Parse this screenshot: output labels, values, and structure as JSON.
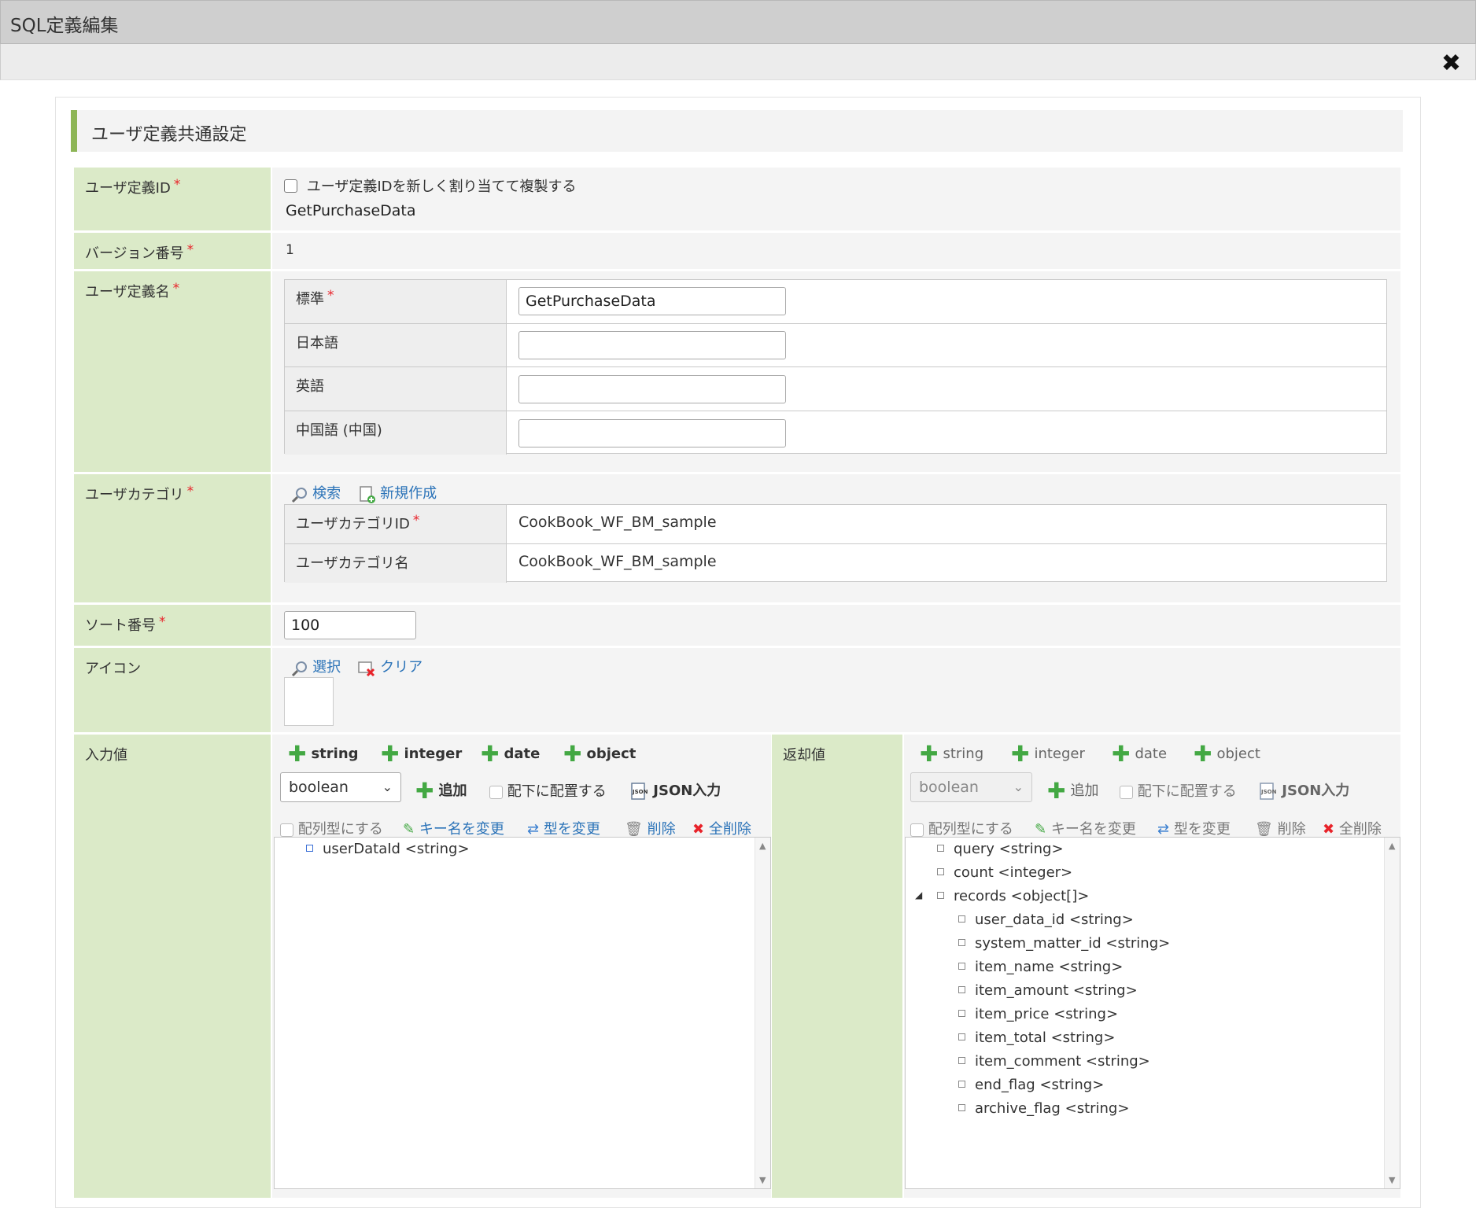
{
  "window": {
    "title": "SQL定義編集",
    "close_icon": "close-icon"
  },
  "section": {
    "title": "ユーザ定義共通設定"
  },
  "required_mark": "*",
  "fields": {
    "user_def_id": {
      "label": "ユーザ定義ID",
      "reassign_checkbox_label": "ユーザ定義IDを新しく割り当てて複製する",
      "reassign_checked": false,
      "value": "GetPurchaseData"
    },
    "version": {
      "label": "バージョン番号",
      "value": "1"
    },
    "user_def_name": {
      "label": "ユーザ定義名",
      "rows": [
        {
          "label": "標準",
          "required": true,
          "value": "GetPurchaseData"
        },
        {
          "label": "日本語",
          "required": false,
          "value": ""
        },
        {
          "label": "英語",
          "required": false,
          "value": ""
        },
        {
          "label": "中国語 (中国)",
          "required": false,
          "value": ""
        }
      ]
    },
    "user_category": {
      "label": "ユーザカテゴリ",
      "search_label": "検索",
      "new_label": "新規作成",
      "id_label": "ユーザカテゴリID",
      "id_value": "CookBook_WF_BM_sample",
      "name_label": "ユーザカテゴリ名",
      "name_value": "CookBook_WF_BM_sample"
    },
    "sort_number": {
      "label": "ソート番号",
      "value": "100"
    },
    "icon": {
      "label": "アイコン",
      "select_label": "選択",
      "clear_label": "クリア"
    }
  },
  "input_values": {
    "label": "入力値",
    "type_buttons": [
      "string",
      "integer",
      "date",
      "object"
    ],
    "type_select": "boolean",
    "add_label": "追加",
    "place_under_label": "配下に配置する",
    "json_input_label": "JSON入力",
    "array_label": "配列型にする",
    "rename_label": "キー名を変更",
    "retype_label": "型を変更",
    "delete_label": "削除",
    "delete_all_label": "全削除",
    "tree": [
      {
        "name": "userDataId",
        "type": "<string>"
      }
    ]
  },
  "return_values": {
    "label": "返却値",
    "type_buttons": [
      "string",
      "integer",
      "date",
      "object"
    ],
    "type_select": "boolean",
    "add_label": "追加",
    "place_under_label": "配下に配置する",
    "json_input_label": "JSON入力",
    "array_label": "配列型にする",
    "rename_label": "キー名を変更",
    "retype_label": "型を変更",
    "delete_label": "削除",
    "delete_all_label": "全削除",
    "tree": [
      {
        "name": "query",
        "type": "<string>"
      },
      {
        "name": "count",
        "type": "<integer>"
      },
      {
        "name": "records",
        "type": "<object[]>",
        "expanded": true,
        "children": [
          {
            "name": "user_data_id",
            "type": "<string>"
          },
          {
            "name": "system_matter_id",
            "type": "<string>"
          },
          {
            "name": "item_name",
            "type": "<string>"
          },
          {
            "name": "item_amount",
            "type": "<string>"
          },
          {
            "name": "item_price",
            "type": "<string>"
          },
          {
            "name": "item_total",
            "type": "<string>"
          },
          {
            "name": "item_comment",
            "type": "<string>"
          },
          {
            "name": "end_flag",
            "type": "<string>"
          },
          {
            "name": "archive_flag",
            "type": "<string>"
          }
        ]
      }
    ]
  },
  "colors": {
    "label_bg": "#dbeac8",
    "accent": "#8db556",
    "link": "#2b73b8",
    "required": "#e8232a",
    "plus": "#43a843"
  }
}
